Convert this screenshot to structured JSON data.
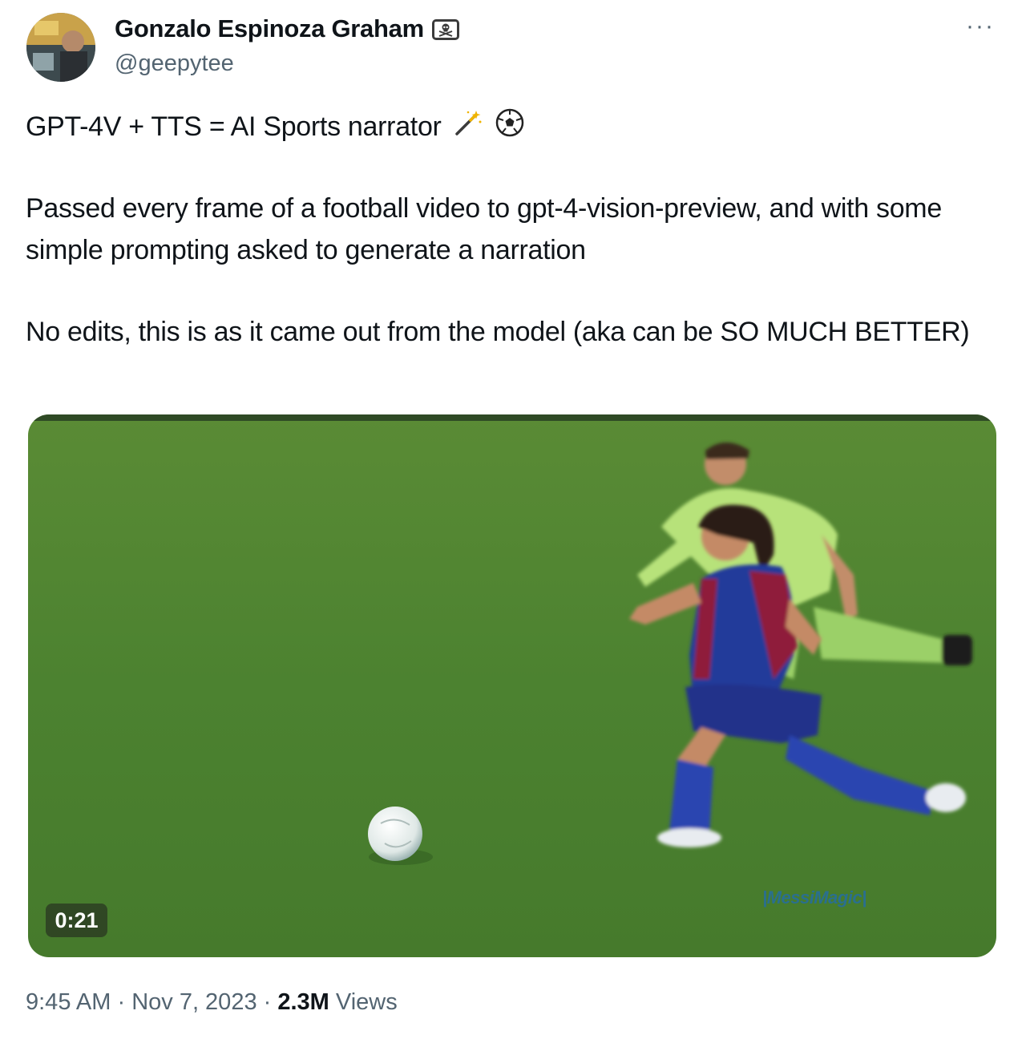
{
  "author": {
    "display_name": "Gonzalo Espinoza Graham",
    "handle": "@geepytee",
    "badge_icon": "skull-crossbones-icon"
  },
  "more_label": "···",
  "post": {
    "line1": "GPT-4V + TTS = AI Sports narrator",
    "line1_emojis": [
      "magic-wand-icon",
      "soccer-ball-icon"
    ],
    "paragraph2": "Passed every frame of a football video to gpt-4-vision-preview, and with some simple prompting asked to generate a narration",
    "paragraph3": "No edits, this is as it came out from the model (aka can be SO MUCH BETTER)"
  },
  "video": {
    "duration": "0:21",
    "watermark": "|MessiMagic|"
  },
  "meta": {
    "time": "9:45 AM",
    "sep1": " · ",
    "date": "Nov 7, 2023",
    "sep2": " · ",
    "views_count": "2.3M",
    "views_label": " Views"
  },
  "colors": {
    "text": "#0f1419",
    "secondary": "#536471",
    "pitch": "#4f8a2f"
  }
}
